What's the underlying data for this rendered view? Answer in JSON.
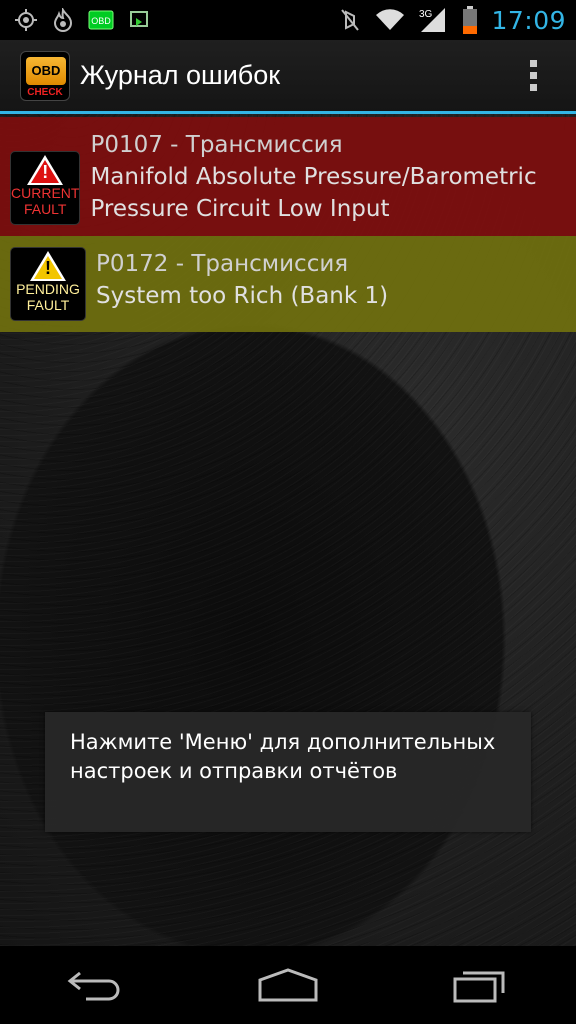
{
  "status_bar": {
    "icons_left": [
      "gps-icon",
      "flame-icon",
      "obd-icon",
      "cast-icon"
    ],
    "obd_label": "OBD",
    "icons_right": [
      "mute-icon",
      "wifi-icon",
      "signal-icon",
      "battery-icon"
    ],
    "network_type": "3G",
    "time": "17:09",
    "accent_color": "#33b5e5"
  },
  "action_bar": {
    "title": "Журнал ошибок",
    "app_icon_top": "OBD",
    "app_icon_bottom": "CHECK",
    "menu_icon": "overflow-menu-icon"
  },
  "faults": [
    {
      "code_line": "P0107 - Трансмиссия",
      "description": "Manifold Absolute Pressure/Barometric Pressure Circuit Low Input",
      "badge_line1": "CURRENT",
      "badge_line2": "FAULT",
      "status_color": "#7e0e0e"
    },
    {
      "code_line": "P0172 - Трансмиссия",
      "description": "System too Rich (Bank 1)",
      "badge_line1": "PENDING",
      "badge_line2": "FAULT",
      "status_color": "#70700e"
    }
  ],
  "toast": {
    "message": "Нажмите 'Меню' для дополнительных настроек и отправки отчётов"
  },
  "nav_bar": {
    "buttons": [
      "back-icon",
      "home-icon",
      "recent-apps-icon"
    ]
  }
}
